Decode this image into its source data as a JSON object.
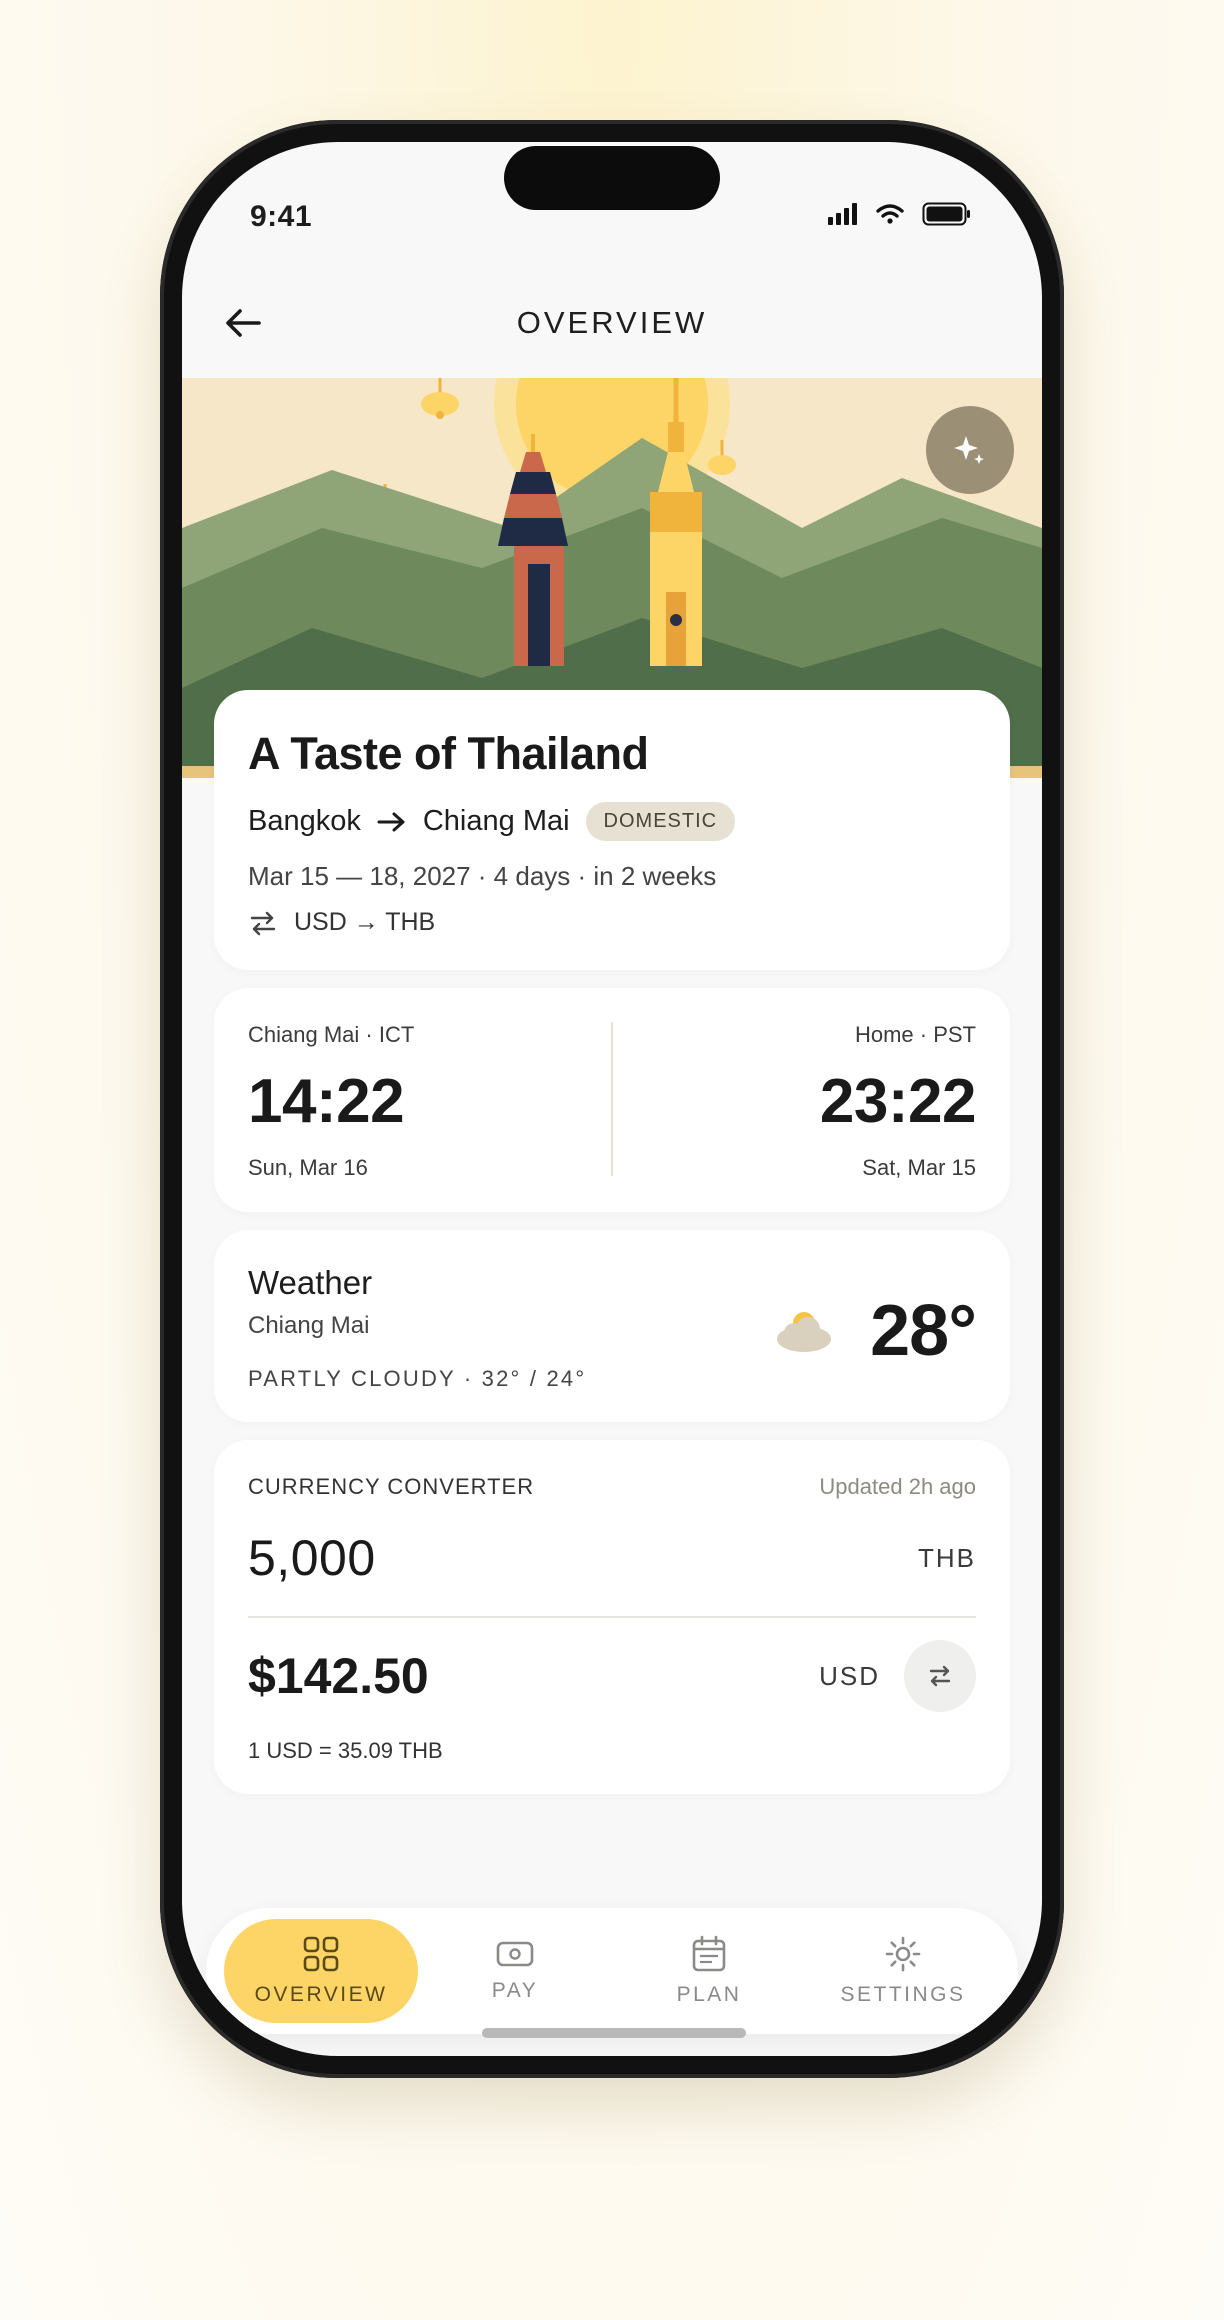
{
  "status_bar": {
    "time": "9:41"
  },
  "header": {
    "title": "OVERVIEW",
    "back_icon": "arrow-left-icon"
  },
  "hero": {
    "action_icon": "sparkle-icon"
  },
  "trip": {
    "title": "A Taste of Thailand",
    "from": "Bangkok",
    "to": "Chiang Mai",
    "badge": "DOMESTIC",
    "dates": "Mar 15 — 18, 2027 · 4 days · in 2 weeks",
    "currency_pair": "USD → THB"
  },
  "timezones": {
    "local": {
      "label": "Chiang Mai · ICT",
      "time": "14:22",
      "date": "Sun, Mar 16"
    },
    "home": {
      "label": "Home · PST",
      "time": "23:22",
      "date": "Sat, Mar 15"
    }
  },
  "weather": {
    "title": "Weather",
    "city": "Chiang Mai",
    "condition": "PARTLY CLOUDY · 32° / 24°",
    "temp": "28°",
    "icon": "partly-cloudy-icon"
  },
  "converter": {
    "label": "CURRENCY CONVERTER",
    "updated": "Updated 2h ago",
    "from_amount": "5,000",
    "from_code": "THB",
    "to_amount": "$142.50",
    "to_code": "USD",
    "rate": "1 USD = 35.09 THB"
  },
  "tabs": [
    {
      "label": "OVERVIEW",
      "icon": "grid-icon",
      "active": true
    },
    {
      "label": "PAY",
      "icon": "cash-icon",
      "active": false
    },
    {
      "label": "PLAN",
      "icon": "calendar-icon",
      "active": false
    },
    {
      "label": "SETTINGS",
      "icon": "gear-icon",
      "active": false
    }
  ],
  "colors": {
    "accent": "#fdd466",
    "hero_sky": "#f6e7c8",
    "hill_light": "#8fa578",
    "hill_mid": "#6e8a5c",
    "hill_dark": "#4f6e49",
    "sparkle_button": "#9b8f76"
  }
}
